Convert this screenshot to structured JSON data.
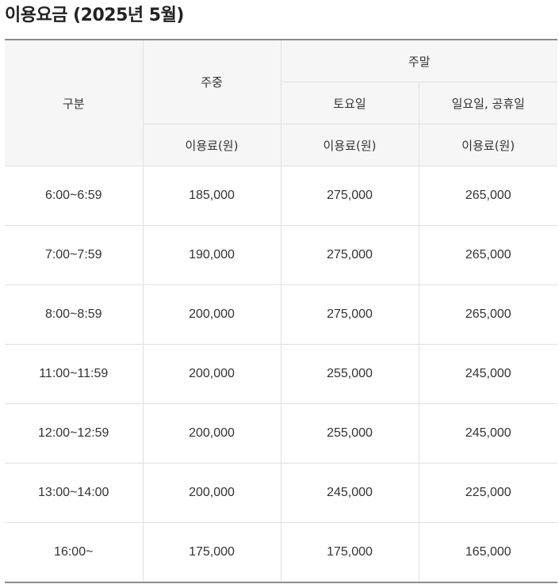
{
  "page": {
    "title": "이용요금 (2025년 5월)"
  },
  "table": {
    "headers": {
      "category": "구분",
      "weekday": "주중",
      "weekend": "주말",
      "saturday": "토요일",
      "sunday_holiday": "일요일, 공휴일",
      "fee_weekday": "이용료(원)",
      "fee_saturday": "이용료(원)",
      "fee_sunday": "이용료(원)"
    },
    "rows": [
      {
        "time": "6:00~6:59",
        "weekday": "185,000",
        "saturday": "275,000",
        "sunday": "265,000"
      },
      {
        "time": "7:00~7:59",
        "weekday": "190,000",
        "saturday": "275,000",
        "sunday": "265,000"
      },
      {
        "time": "8:00~8:59",
        "weekday": "200,000",
        "saturday": "275,000",
        "sunday": "265,000"
      },
      {
        "time": "11:00~11:59",
        "weekday": "200,000",
        "saturday": "255,000",
        "sunday": "245,000"
      },
      {
        "time": "12:00~12:59",
        "weekday": "200,000",
        "saturday": "255,000",
        "sunday": "245,000"
      },
      {
        "time": "13:00~14:00",
        "weekday": "200,000",
        "saturday": "245,000",
        "sunday": "225,000"
      },
      {
        "time": "16:00~",
        "weekday": "175,000",
        "saturday": "175,000",
        "sunday": "165,000"
      }
    ]
  },
  "colors": {
    "header_background": "#f6f6f6",
    "table_rule": "#8c8c8c",
    "cell_border": "#e0e0e0",
    "text": "#333333"
  }
}
